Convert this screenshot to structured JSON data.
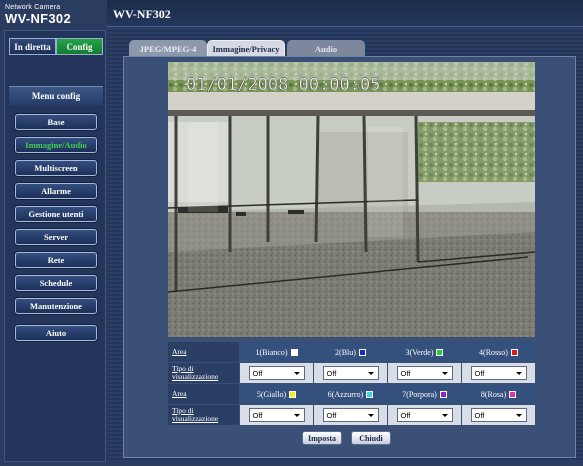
{
  "brand": {
    "small": "Network Camera",
    "model": "WV-NF302"
  },
  "header": {
    "title": "WV-NF302"
  },
  "mode": {
    "live": "In diretta",
    "config": "Config"
  },
  "menu": {
    "title": "Menu config",
    "items": [
      "Base",
      "Immagine/Audio",
      "Multiscreen",
      "Allarme",
      "Gestione utenti",
      "Server",
      "Rete",
      "Schedule",
      "Manutenzione"
    ],
    "help": "Aiuto",
    "active_index": 1
  },
  "tabs": [
    "JPEG/MPEG-4",
    "Immagine/Privacy",
    "Audio"
  ],
  "camera": {
    "timestamp": "01/01/2008 00:00:05"
  },
  "privacy": {
    "area_label": "Area",
    "tipo_label": "Tipo di visualizzazione",
    "row1": [
      {
        "name": "1(Bianco)",
        "color": "#ffffff",
        "value": "Off"
      },
      {
        "name": "2(Blu)",
        "color": "#1428d8",
        "value": "Off"
      },
      {
        "name": "3(Verde)",
        "color": "#20d030",
        "value": "Off"
      },
      {
        "name": "4(Rosso)",
        "color": "#e01818",
        "value": "Off"
      }
    ],
    "row2": [
      {
        "name": "5(Giallo)",
        "color": "#f4ea18",
        "value": "Off"
      },
      {
        "name": "6(Azzurro)",
        "color": "#30d8e8",
        "value": "Off"
      },
      {
        "name": "7(Porpora)",
        "color": "#9020d0",
        "value": "Off"
      },
      {
        "name": "8(Rosa)",
        "color": "#e828c8",
        "value": "Off"
      }
    ]
  },
  "actions": {
    "set": "Imposta",
    "close": "Chiudi"
  }
}
